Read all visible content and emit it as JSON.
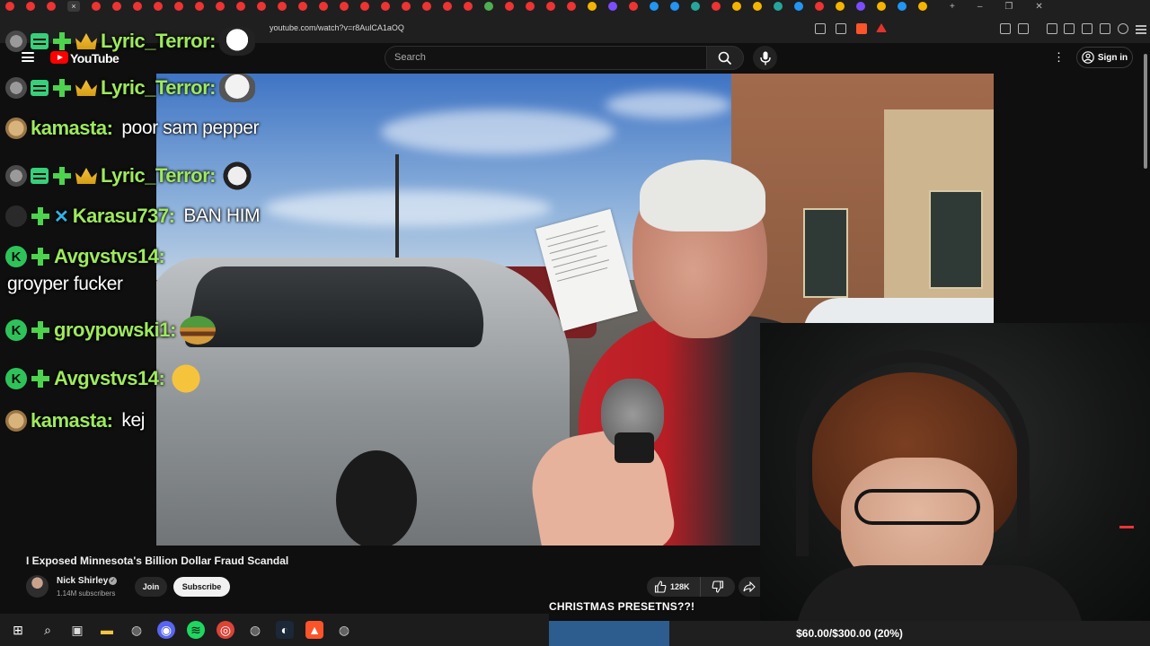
{
  "browser": {
    "url": "youtube.com/watch?v=r8AulCA1aOQ",
    "tab_colors": [
      "#e33",
      "#e33",
      "#e33",
      "#e33",
      "#e33",
      "#e33",
      "#e33",
      "#e33",
      "#e33",
      "#e33",
      "#e33",
      "#e33",
      "#e33",
      "#e33",
      "#e33",
      "#e33",
      "#e33",
      "#e33",
      "#e33",
      "#e33",
      "#e33",
      "#e33",
      "#4caf50",
      "#e33",
      "#e33",
      "#e33",
      "#e33",
      "#f4b400",
      "#7c4dff",
      "#e33",
      "#2196f3",
      "#2196f3",
      "#26a69a",
      "#e33",
      "#f4b400",
      "#f4b400",
      "#26a69a",
      "#2196f3",
      "#e33",
      "#f4b400",
      "#7c4dff",
      "#f4b400",
      "#2196f3",
      "#f4b400"
    ],
    "active_tab_close": "×",
    "window_controls": {
      "new_tab": "+",
      "minimize": "–",
      "restore": "❐",
      "close": "✕"
    }
  },
  "youtube": {
    "logo_text": "YouTube",
    "search_placeholder": "Search",
    "more_icon": "⋮",
    "sign_in_label": "Sign in"
  },
  "video": {
    "title": "I Exposed Minnesota's Billion Dollar Fraud Scandal",
    "channel": "Nick Shirley",
    "verified_mark": "✓",
    "subscribers": "1.14M subscribers",
    "join_label": "Join",
    "subscribe_label": "Subscribe",
    "likes": "128K"
  },
  "chat": [
    {
      "user": "Lyric_Terror:",
      "message": "",
      "badges": [
        "avatar-gray",
        "sub",
        "plus",
        "crown"
      ],
      "emote": "skull"
    },
    {
      "user": "Lyric_Terror:",
      "message": "",
      "badges": [
        "avatar-gray",
        "sub",
        "plus",
        "crown"
      ],
      "emote": "face"
    },
    {
      "user": "kamasta:",
      "message": "poor sam pepper",
      "badges": [
        "avatar-tan"
      ],
      "emote": ""
    },
    {
      "user": "Lyric_Terror:",
      "message": "",
      "badges": [
        "avatar-gray",
        "sub",
        "plus",
        "crown"
      ],
      "emote": "sketch"
    },
    {
      "user": "Karasu737:",
      "message": "BAN HIM",
      "badges": [
        "avatar-dark",
        "plus",
        "sword"
      ],
      "emote": ""
    },
    {
      "user": "Avgvstvs14:",
      "message": "groyper fucker",
      "badges": [
        "k",
        "plus"
      ],
      "emote": ""
    },
    {
      "user": "groypowski1:",
      "message": "",
      "badges": [
        "k",
        "plus"
      ],
      "emote": "pepe-burger"
    },
    {
      "user": "Avgvstvs14:",
      "message": "",
      "badges": [
        "k",
        "plus"
      ],
      "emote": "relieved"
    },
    {
      "user": "kamasta:",
      "message": "kej",
      "badges": [
        "avatar-tan"
      ],
      "emote": ""
    }
  ],
  "stream_overlay": {
    "goal_label": "CHRISTMAS PRESETNS??!",
    "goal_text": "$60.00/$300.00 (20%)",
    "goal_current": 60,
    "goal_target": 300,
    "goal_fraction": 0.2
  },
  "taskbar": {
    "icons": [
      "windows-icon",
      "search-icon",
      "task-view-icon",
      "file-explorer-icon",
      "app-icon",
      "discord-icon",
      "spotify-icon",
      "chrome-icon",
      "app-icon",
      "steam-icon",
      "brave-icon",
      "app-icon"
    ]
  }
}
